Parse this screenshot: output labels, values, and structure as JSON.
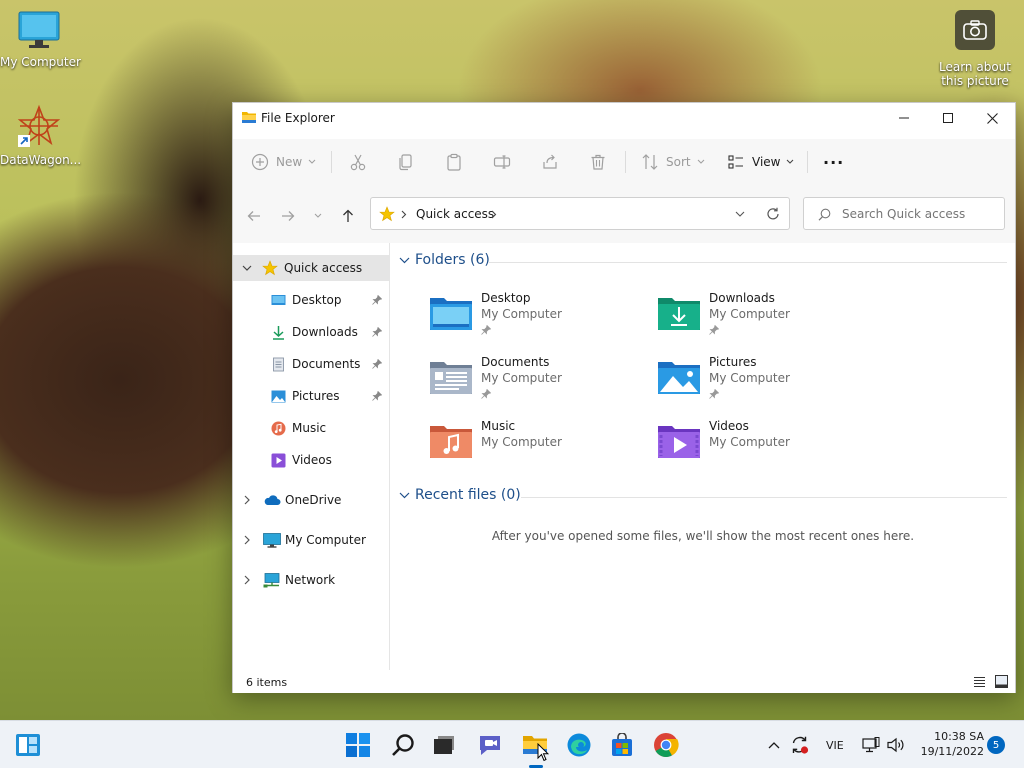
{
  "desktop": {
    "icons": [
      {
        "label": "My Computer",
        "icon": "monitor-icon"
      },
      {
        "label": "DataWagon...",
        "icon": "datawagon-shortcut-icon"
      }
    ],
    "spotlight": {
      "line1": "Learn about",
      "line2": "this picture",
      "icon": "camera-icon"
    }
  },
  "window": {
    "title": "File Explorer",
    "toolbar": {
      "new_label": "New",
      "sort_label": "Sort",
      "view_label": "View",
      "more_label": "···"
    },
    "address": {
      "location": "Quick access"
    },
    "search": {
      "placeholder": "Search Quick access"
    },
    "sidebar": {
      "quick_access": "Quick access",
      "pinned": [
        {
          "label": "Desktop"
        },
        {
          "label": "Downloads"
        },
        {
          "label": "Documents"
        },
        {
          "label": "Pictures"
        },
        {
          "label": "Music"
        },
        {
          "label": "Videos"
        }
      ],
      "onedrive": "OneDrive",
      "my_computer": "My Computer",
      "network": "Network"
    },
    "content": {
      "folders_header": "Folders (6)",
      "folders": [
        {
          "name": "Desktop",
          "location": "My Computer"
        },
        {
          "name": "Downloads",
          "location": "My Computer"
        },
        {
          "name": "Documents",
          "location": "My Computer"
        },
        {
          "name": "Pictures",
          "location": "My Computer"
        },
        {
          "name": "Music",
          "location": "My Computer"
        },
        {
          "name": "Videos",
          "location": "My Computer"
        }
      ],
      "recent_header": "Recent files (0)",
      "recent_empty": "After you've opened some files, we'll show the most recent ones here."
    },
    "status": {
      "items": "6 items"
    }
  },
  "taskbar": {
    "language": "VIE",
    "time": "10:38 SA",
    "date": "19/11/2022",
    "notifications": "5"
  },
  "colors": {
    "accent": "#0067c0",
    "selection": "#e5e5e5"
  }
}
